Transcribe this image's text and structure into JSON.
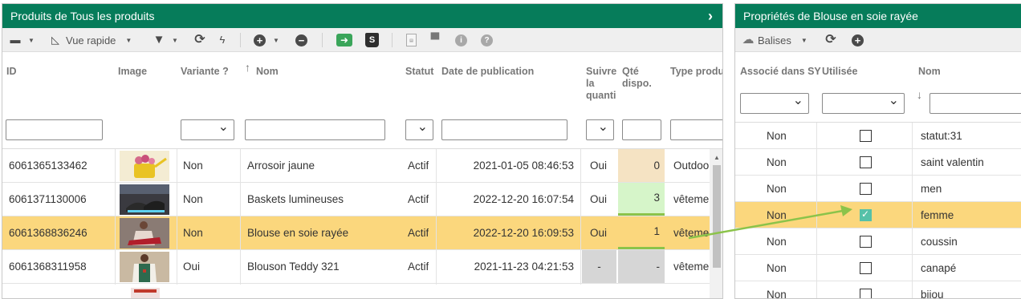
{
  "left": {
    "title": "Produits de Tous les produits",
    "toolbar": {
      "view_label": "Vue rapide"
    },
    "columns": {
      "id": "ID",
      "image": "Image",
      "variante": "Variante ?",
      "nom": "Nom",
      "statut": "Statut",
      "date": "Date de publication",
      "suivre": "Suivre la quanti",
      "qte": "Qté dispo.",
      "type": "Type produ"
    },
    "rows": [
      {
        "id": "6061365133462",
        "variante": "Non",
        "nom": "Arrosoir jaune",
        "statut": "Actif",
        "date": "2021-01-05 08:46:53",
        "suivre": "Oui",
        "qte": "0",
        "type": "Outdoor"
      },
      {
        "id": "6061371130006",
        "variante": "Non",
        "nom": "Baskets lumineuses",
        "statut": "Actif",
        "date": "2022-12-20 16:07:54",
        "suivre": "Oui",
        "qte": "3",
        "type": "vêtement"
      },
      {
        "id": "6061368836246",
        "variante": "Non",
        "nom": "Blouse en soie rayée",
        "statut": "Actif",
        "date": "2022-12-20 16:09:53",
        "suivre": "Oui",
        "qte": "1",
        "type": "vêtement"
      },
      {
        "id": "6061368311958",
        "variante": "Oui",
        "nom": "Blouson Teddy 321",
        "statut": "Actif",
        "date": "2021-11-23 04:21:53",
        "suivre": "-",
        "qte": "-",
        "type": "vêtement"
      }
    ]
  },
  "right": {
    "title": "Propriétés de Blouse en soie rayée",
    "toolbar": {
      "tags_label": "Balises"
    },
    "columns": {
      "assoc": "Associé dans SY",
      "utilisee": "Utilisée",
      "nom": "Nom"
    },
    "rows": [
      {
        "assoc": "Non",
        "checked": false,
        "nom": "statut:31"
      },
      {
        "assoc": "Non",
        "checked": false,
        "nom": "saint valentin"
      },
      {
        "assoc": "Non",
        "checked": false,
        "nom": "men"
      },
      {
        "assoc": "Non",
        "checked": true,
        "nom": "femme"
      },
      {
        "assoc": "Non",
        "checked": false,
        "nom": "coussin"
      },
      {
        "assoc": "Non",
        "checked": false,
        "nom": "canapé"
      },
      {
        "assoc": "Non",
        "checked": false,
        "nom": "bijou"
      }
    ]
  },
  "colors": {
    "header_green": "#067c5a",
    "selected_row": "#fbd77d",
    "arrow": "#8bc34a"
  }
}
